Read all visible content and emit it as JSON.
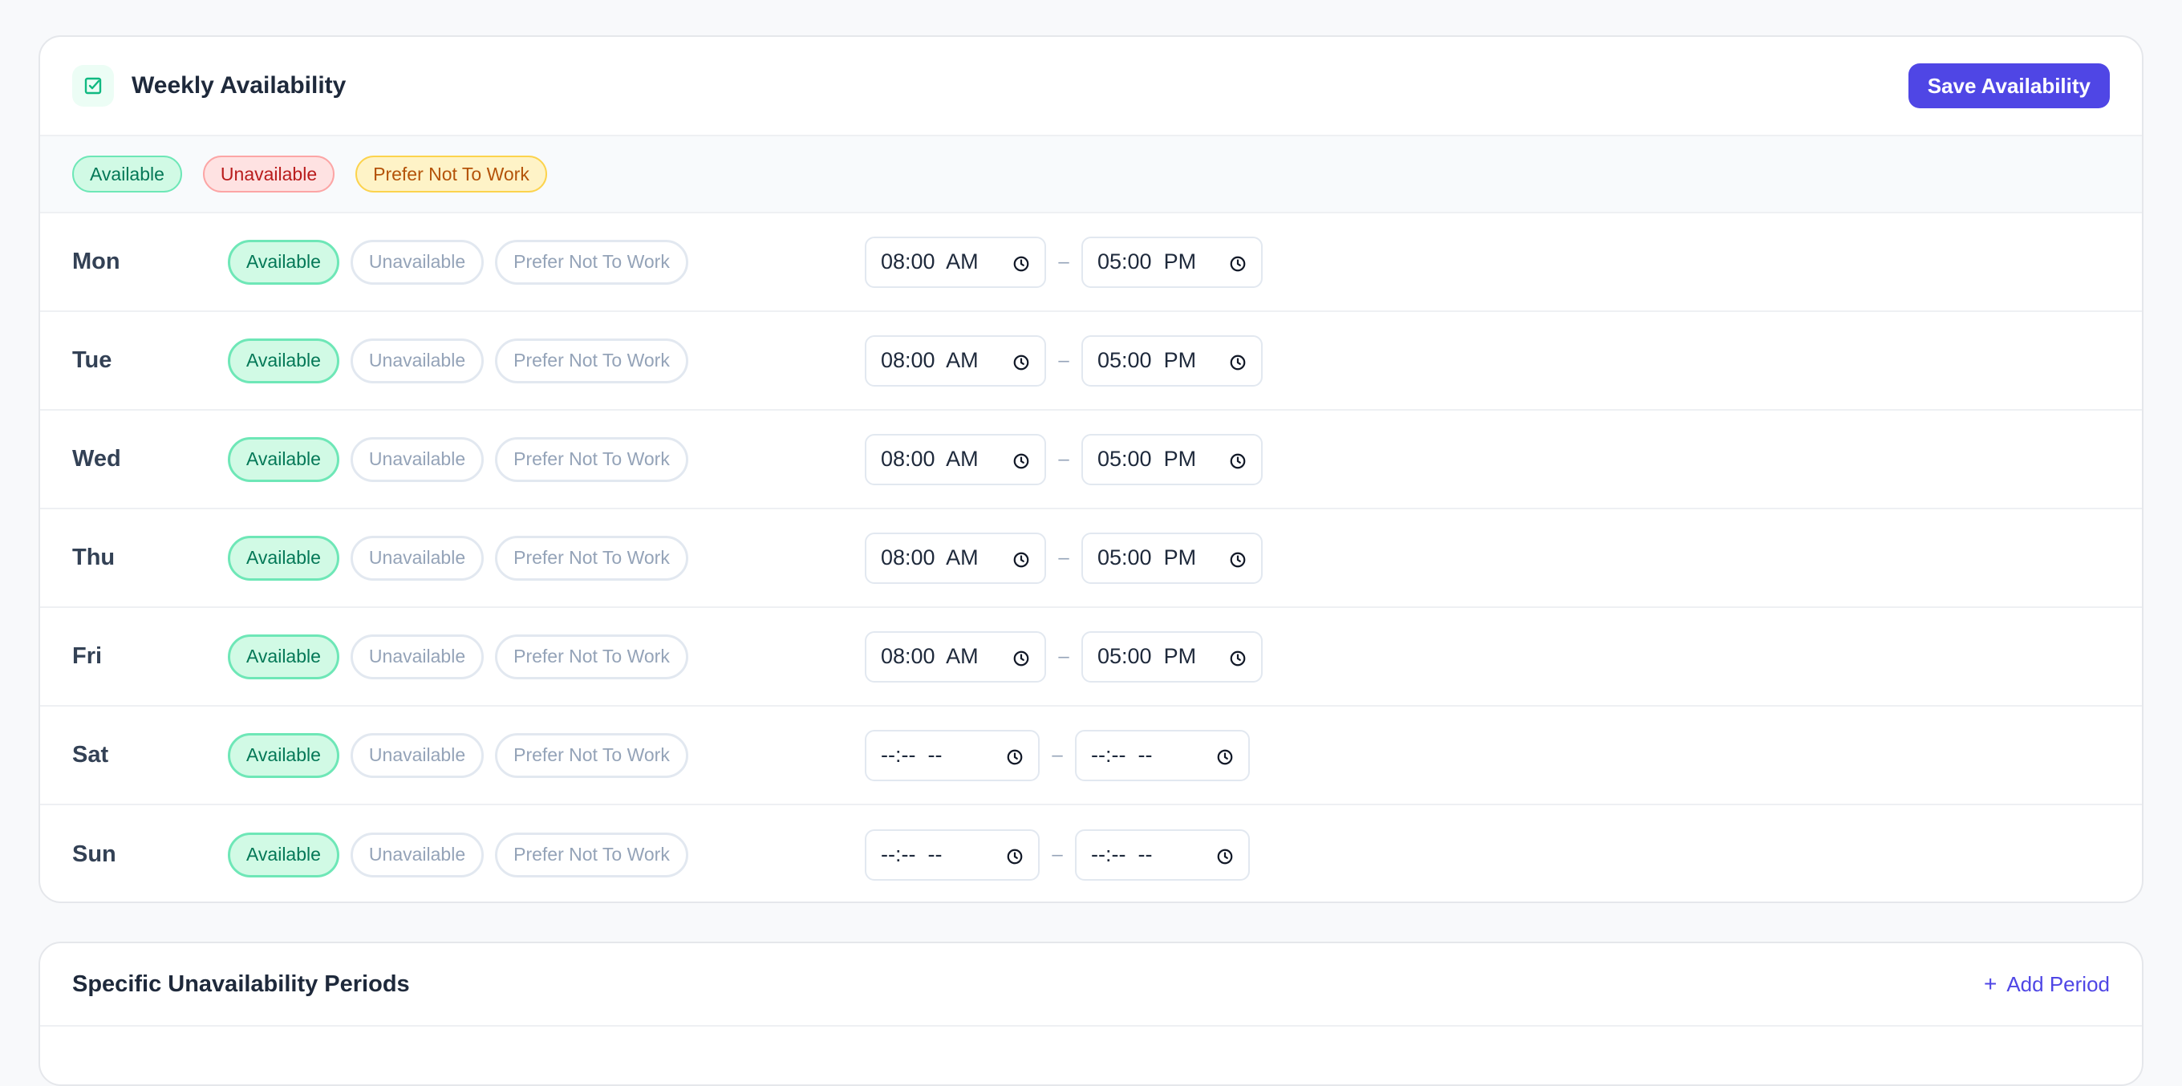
{
  "availability": {
    "title": "Weekly Availability",
    "save_label": "Save Availability",
    "legend": [
      "Available",
      "Unavailable",
      "Prefer Not To Work"
    ],
    "status_options": [
      "Available",
      "Unavailable",
      "Prefer Not To Work"
    ],
    "time_separator": "–",
    "days": [
      {
        "label": "Mon",
        "status": "Available",
        "start": "08:00  AM",
        "end": "05:00  PM"
      },
      {
        "label": "Tue",
        "status": "Available",
        "start": "08:00  AM",
        "end": "05:00  PM"
      },
      {
        "label": "Wed",
        "status": "Available",
        "start": "08:00  AM",
        "end": "05:00  PM"
      },
      {
        "label": "Thu",
        "status": "Available",
        "start": "08:00  AM",
        "end": "05:00  PM"
      },
      {
        "label": "Fri",
        "status": "Available",
        "start": "08:00  AM",
        "end": "05:00  PM"
      },
      {
        "label": "Sat",
        "status": "Available",
        "start": "--:--  --",
        "end": "--:--  --"
      },
      {
        "label": "Sun",
        "status": "Available",
        "start": "--:--  --",
        "end": "--:--  --"
      }
    ],
    "colors": {
      "accent": "#4f46e5",
      "available": "#047857",
      "unavailable": "#b91c1c",
      "prefer": "#b45309"
    },
    "icon": "calendar-check-icon"
  },
  "periods": {
    "title": "Specific Unavailability Periods",
    "add_label": "Add Period",
    "add_icon": "plus-icon"
  }
}
